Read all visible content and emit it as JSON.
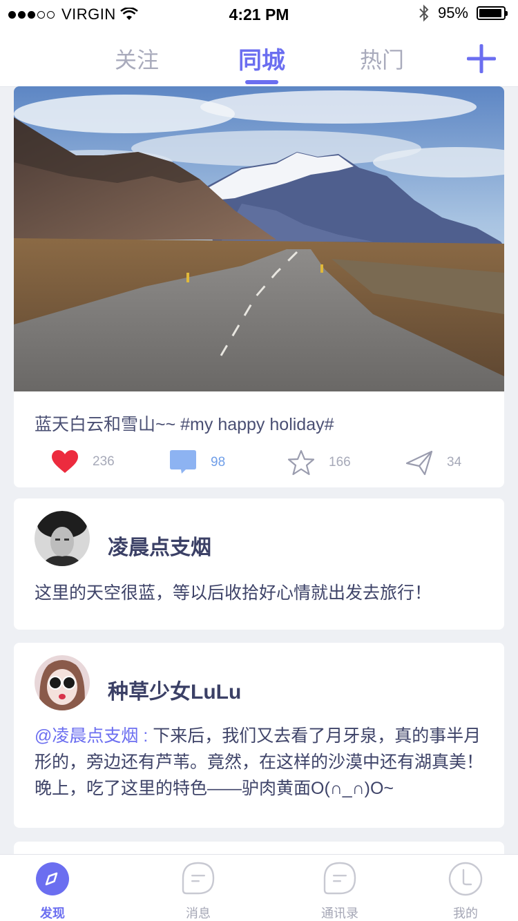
{
  "status_bar": {
    "carrier": "VIRGIN",
    "time": "4:21 PM",
    "battery": "95%",
    "battery_level": 0.95
  },
  "top_nav": {
    "tabs": [
      {
        "label": "关注",
        "active": false
      },
      {
        "label": "同城",
        "active": true
      },
      {
        "label": "热门",
        "active": false
      }
    ],
    "add_icon": "plus-icon",
    "accent_color": "#6b6ef0"
  },
  "feed": {
    "photo_post": {
      "caption": "蓝天白云和雪山~~ #my happy holiday#",
      "likes": "236",
      "comments": "98",
      "stars": "166",
      "shares": "34"
    },
    "posts": [
      {
        "username": "凌晨点支烟",
        "text": "这里的天空很蓝，等以后收拾好心情就出发去旅行！"
      },
      {
        "username": "种草少女LuLu",
        "mention": "@凌晨点支烟 :",
        "text": " 下来后，我们又去看了月牙泉，真的事半月形的，旁边还有芦苇。竟然，在这样的沙漠中还有湖真美！晚上，吃了这里的特色——驴肉黄面O(∩_∩)O~"
      }
    ]
  },
  "tab_bar": {
    "items": [
      {
        "label": "发现",
        "icon": "compass-icon",
        "active": true
      },
      {
        "label": "消息",
        "icon": "message-icon",
        "active": false
      },
      {
        "label": "通讯录",
        "icon": "contacts-icon",
        "active": false
      },
      {
        "label": "我的",
        "icon": "profile-icon",
        "active": false
      }
    ]
  }
}
